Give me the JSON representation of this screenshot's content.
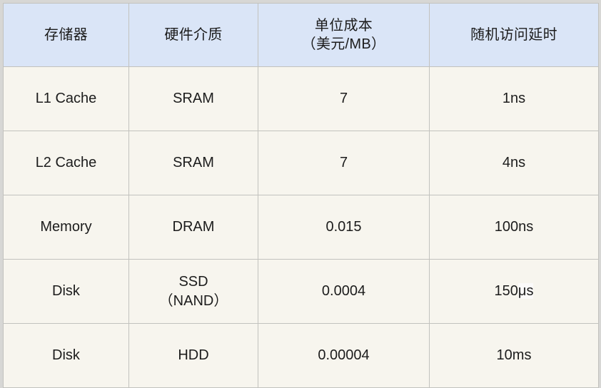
{
  "table": {
    "columns": [
      {
        "key": "storage",
        "label": "存储器"
      },
      {
        "key": "medium",
        "label": "硬件介质"
      },
      {
        "key": "cost",
        "label_line1": "单位成本",
        "label_line2": "（美元/MB）"
      },
      {
        "key": "latency",
        "label": "随机访问延时"
      }
    ],
    "rows": [
      {
        "storage": "L1 Cache",
        "medium": "SRAM",
        "cost": "7",
        "latency": "1ns"
      },
      {
        "storage": "L2 Cache",
        "medium": "SRAM",
        "cost": "7",
        "latency": "4ns"
      },
      {
        "storage": "Memory",
        "medium": "DRAM",
        "cost": "0.015",
        "latency": "100ns"
      },
      {
        "storage": "Disk",
        "medium_line1": "SSD",
        "medium_line2": "（NAND）",
        "cost": "0.0004",
        "latency_value": "150",
        "latency_unit": "μs"
      },
      {
        "storage": "Disk",
        "medium": "HDD",
        "cost": "0.00004",
        "latency": "10ms"
      }
    ]
  },
  "colors": {
    "header_background": "#dae5f7",
    "body_background": "#f7f5ee",
    "border": "#c2c2be",
    "page_background": "#d7d7d5",
    "text": "#1c1c1c"
  }
}
